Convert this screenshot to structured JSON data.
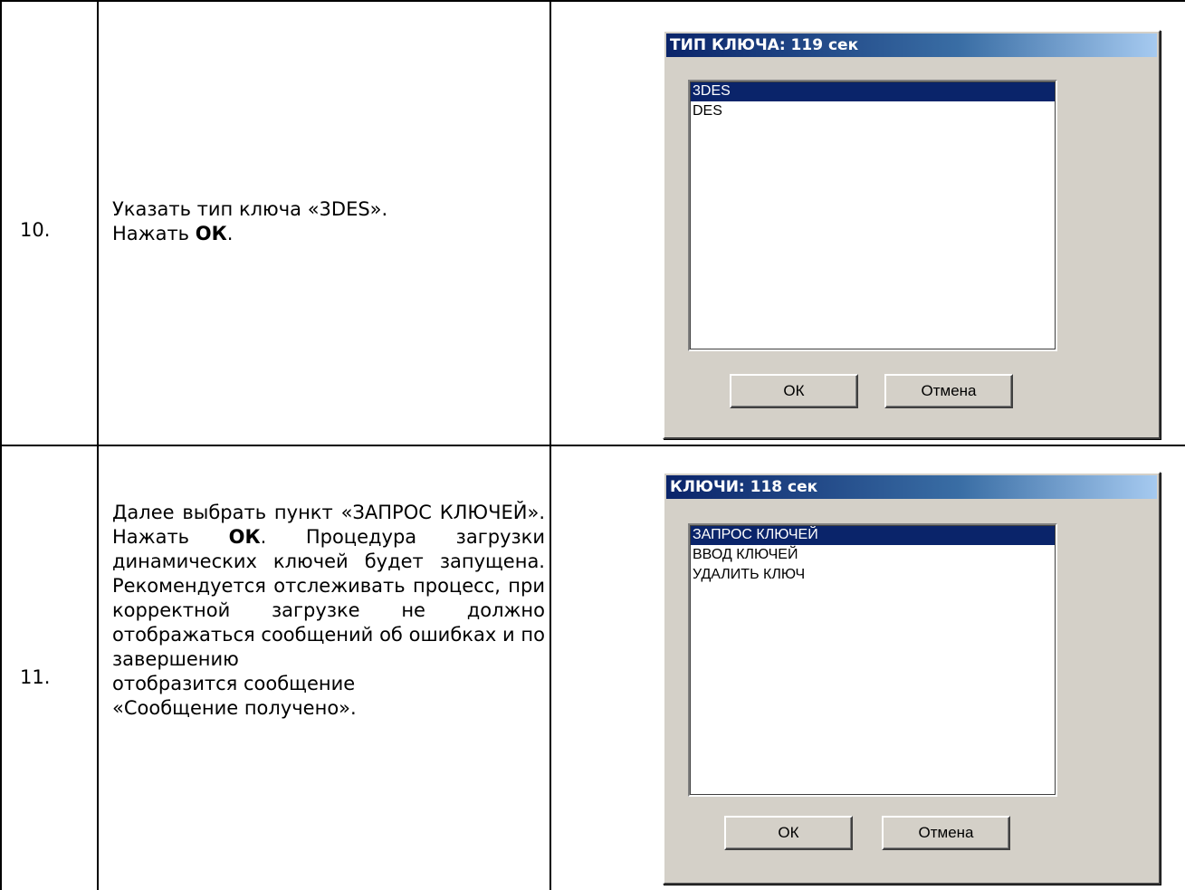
{
  "rows": [
    {
      "number": "10.",
      "lines": [
        "Указать тип ключа «3DES».",
        "Нажать ",
        "ОК",
        "."
      ],
      "dialog": {
        "title": "ТИП КЛЮЧА: 119 сек",
        "items": [
          "3DES",
          "DES"
        ],
        "selected_index": 0,
        "ok_label": "ОК",
        "cancel_label": "Отмена"
      }
    },
    {
      "number": "11.",
      "text_before_ok1": "Далее выбрать пункт «ЗАПРОС КЛЮЧЕЙ». Нажать ",
      "ok_bold": "ОК",
      "text_after_ok1": ". Процедура загрузки динамических ключей будет запущена. Рекомендуется отслеживать процесс, при корректной загрузке не должно отображаться сообщений об ошибках и по завершению",
      "text_last1": "отобразится сообщение",
      "text_last2": "«Сообщение получено».",
      "dialog": {
        "title": "КЛЮЧИ: 118 сек",
        "items": [
          "ЗАПРОС КЛЮЧЕЙ",
          "ВВОД КЛЮЧЕЙ",
          "УДАЛИТЬ КЛЮЧ"
        ],
        "selected_index": 0,
        "ok_label": "ОК",
        "cancel_label": "Отмена"
      }
    }
  ]
}
